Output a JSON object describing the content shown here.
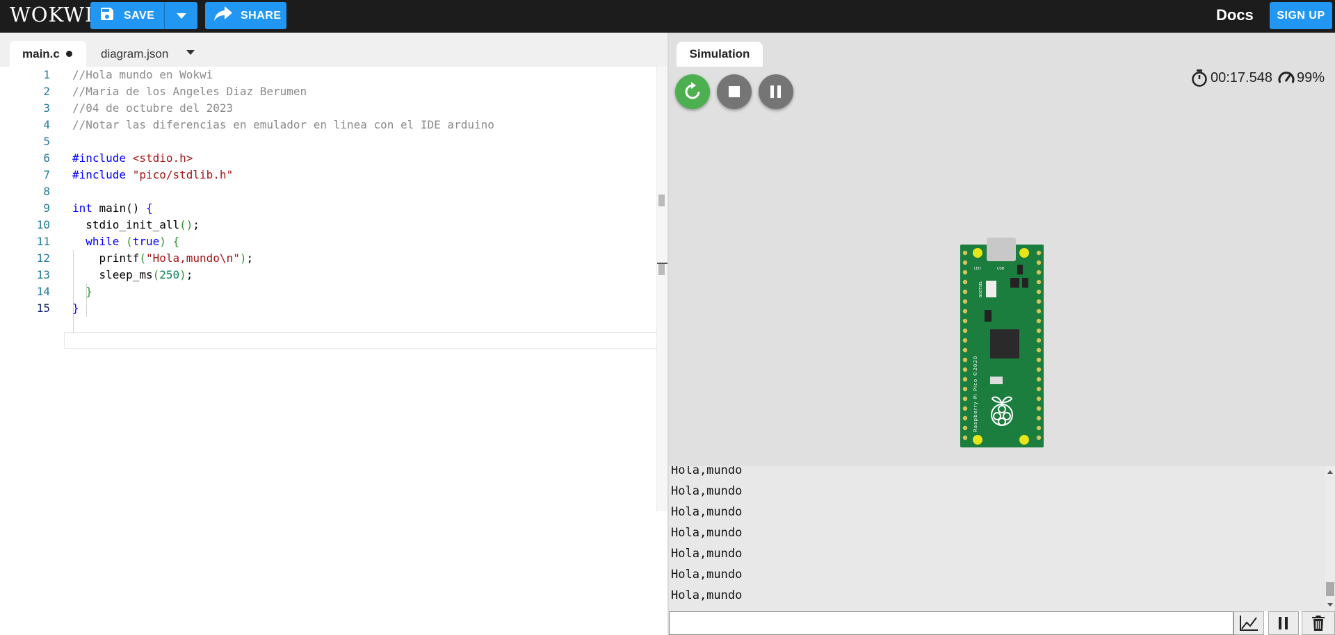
{
  "app": {
    "logo": "WOKWI",
    "save_label": "SAVE",
    "share_label": "SHARE",
    "docs_label": "Docs",
    "signup_label": "SIGN UP"
  },
  "editor": {
    "tabs": [
      {
        "label": "main.c",
        "modified": true
      },
      {
        "label": "diagram.json"
      }
    ],
    "current_line": 15,
    "lines": [
      {
        "n": "1",
        "segs": [
          {
            "t": "//Hola mundo en Wokwi",
            "c": "cm"
          }
        ]
      },
      {
        "n": "2",
        "segs": [
          {
            "t": "//Maria de los Angeles Diaz Berumen",
            "c": "cm"
          }
        ]
      },
      {
        "n": "3",
        "segs": [
          {
            "t": "//04 de octubre del 2023",
            "c": "cm"
          }
        ]
      },
      {
        "n": "4",
        "segs": [
          {
            "t": "//Notar las diferencias en emulador en linea con el IDE arduino",
            "c": "cm"
          }
        ]
      },
      {
        "n": "5",
        "segs": []
      },
      {
        "n": "6",
        "segs": [
          {
            "t": "#include ",
            "c": "pp"
          },
          {
            "t": "<stdio.h>",
            "c": "str"
          }
        ]
      },
      {
        "n": "7",
        "segs": [
          {
            "t": "#include ",
            "c": "pp"
          },
          {
            "t": "\"pico/stdlib.h\"",
            "c": "str"
          }
        ]
      },
      {
        "n": "8",
        "segs": []
      },
      {
        "n": "9",
        "segs": [
          {
            "t": "int",
            "c": "kw"
          },
          {
            "t": " main() ",
            "c": ""
          },
          {
            "t": "{",
            "c": "kw"
          }
        ]
      },
      {
        "n": "10",
        "segs": [
          {
            "t": "  stdio_init_all",
            "c": ""
          },
          {
            "t": "()",
            "c": "br"
          },
          {
            "t": ";",
            "c": ""
          }
        ]
      },
      {
        "n": "11",
        "segs": [
          {
            "t": "  ",
            "c": ""
          },
          {
            "t": "while",
            "c": "kw"
          },
          {
            "t": " (",
            "c": "br"
          },
          {
            "t": "true",
            "c": "kw"
          },
          {
            "t": ")",
            "c": "br"
          },
          {
            "t": " {",
            "c": "br"
          }
        ]
      },
      {
        "n": "12",
        "segs": [
          {
            "t": "    printf",
            "c": ""
          },
          {
            "t": "(",
            "c": "br"
          },
          {
            "t": "\"Hola,mundo\\n\"",
            "c": "str"
          },
          {
            "t": ")",
            "c": "br"
          },
          {
            "t": ";",
            "c": ""
          }
        ]
      },
      {
        "n": "13",
        "segs": [
          {
            "t": "    sleep_ms",
            "c": ""
          },
          {
            "t": "(",
            "c": "br"
          },
          {
            "t": "250",
            "c": "num"
          },
          {
            "t": ")",
            "c": "br"
          },
          {
            "t": ";",
            "c": ""
          }
        ]
      },
      {
        "n": "14",
        "segs": [
          {
            "t": "  }",
            "c": "br"
          }
        ]
      },
      {
        "n": "15",
        "segs": [
          {
            "t": "}",
            "c": "kw"
          }
        ]
      }
    ]
  },
  "simulation": {
    "tab_label": "Simulation",
    "time": "00:17.548",
    "speed": "99%"
  },
  "board": {
    "usb_label": "USB",
    "led_label": "LED",
    "bootsel_label": "BOOTSEL",
    "name_label": "Raspberry Pi Pico ©2020"
  },
  "serial": {
    "lines": [
      "Hola,mundo",
      "Hola,mundo",
      "Hola,mundo",
      "Hola,mundo",
      "Hola,mundo",
      "Hola,mundo",
      "Hola,mundo"
    ],
    "input_value": ""
  }
}
